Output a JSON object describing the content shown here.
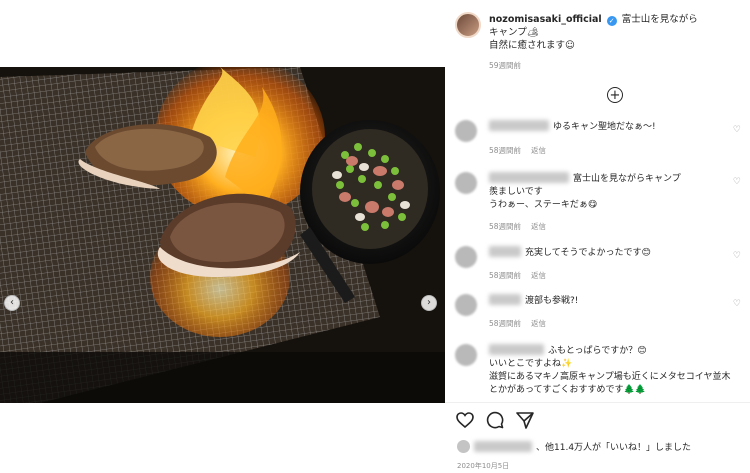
{
  "post": {
    "username": "nozomisasaki_official",
    "caption_line1": "富士山を見ながら",
    "caption_line2": "キャンプ🏕",
    "caption_line3": "自然に癒されます☺",
    "caption_time": "59週間前"
  },
  "comments": [
    {
      "text": "ゆるキャン聖地だなぁ～!",
      "time": "58週間前",
      "reply": "返信"
    },
    {
      "text": "富士山を見ながらキャンプ",
      "text2": "羨ましいです",
      "text3": "うわぁー、ステーキだぁ😋",
      "time": "58週間前",
      "reply": "返信"
    },
    {
      "text": "充実してそうでよかったです😊",
      "time": "58週間前",
      "reply": "返信"
    },
    {
      "text": "渡部も参戦?!",
      "time": "58週間前",
      "reply": "返信"
    },
    {
      "text": "ふもとっぱらですか？😊",
      "text2": "いいとこですよね✨",
      "text3": "滋賀にあるマキノ高原キャンプ場も近くにメタセコイヤ並木",
      "text4": "とかがあってすごくおすすめです🌲🌲"
    }
  ],
  "likes": {
    "text": "、他11.4万人が「いいね！」しました"
  },
  "date": "2020年10月5日",
  "icons": [
    "verified-icon",
    "add-comment-icon",
    "heart-icon",
    "comment-icon",
    "share-icon",
    "carousel-prev-icon",
    "carousel-next-icon"
  ]
}
